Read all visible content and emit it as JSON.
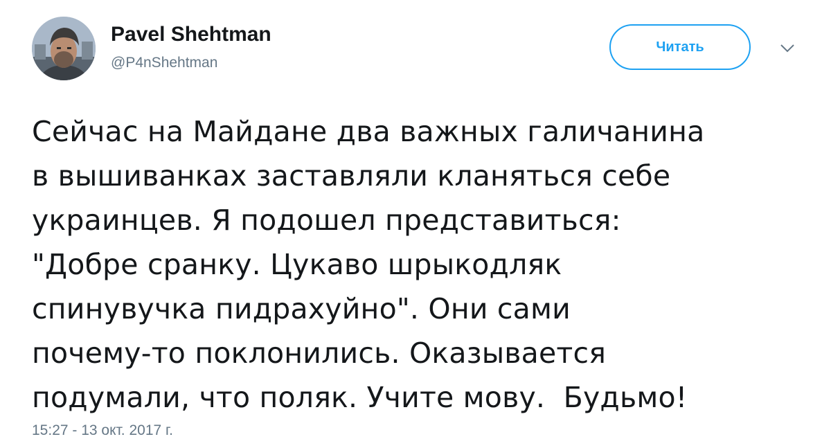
{
  "author": {
    "name": "Pavel Shehtman",
    "handle": "@P4nShehtman"
  },
  "follow_button": {
    "label": "Читать"
  },
  "caret_icon": "chevron-down-icon",
  "tweet": {
    "lines": [
      "Сейчас на Майдане два важных галичанина",
      "в вышиванках заставляли кланяться себе",
      "украинцев. Я подошел представиться:",
      "\"Добре сранку. Цукаво шрыкодляк",
      "спинувучка пидрахуйно\". Они сами",
      "почему-то поклонились. Оказывается",
      "подумали, что поляк. Учите мову.  Будьмо!"
    ],
    "timestamp": "15:27 - 13 окт. 2017 г."
  },
  "colors": {
    "accent": "#1da1f2",
    "text": "#14171a",
    "secondary": "#657786"
  }
}
